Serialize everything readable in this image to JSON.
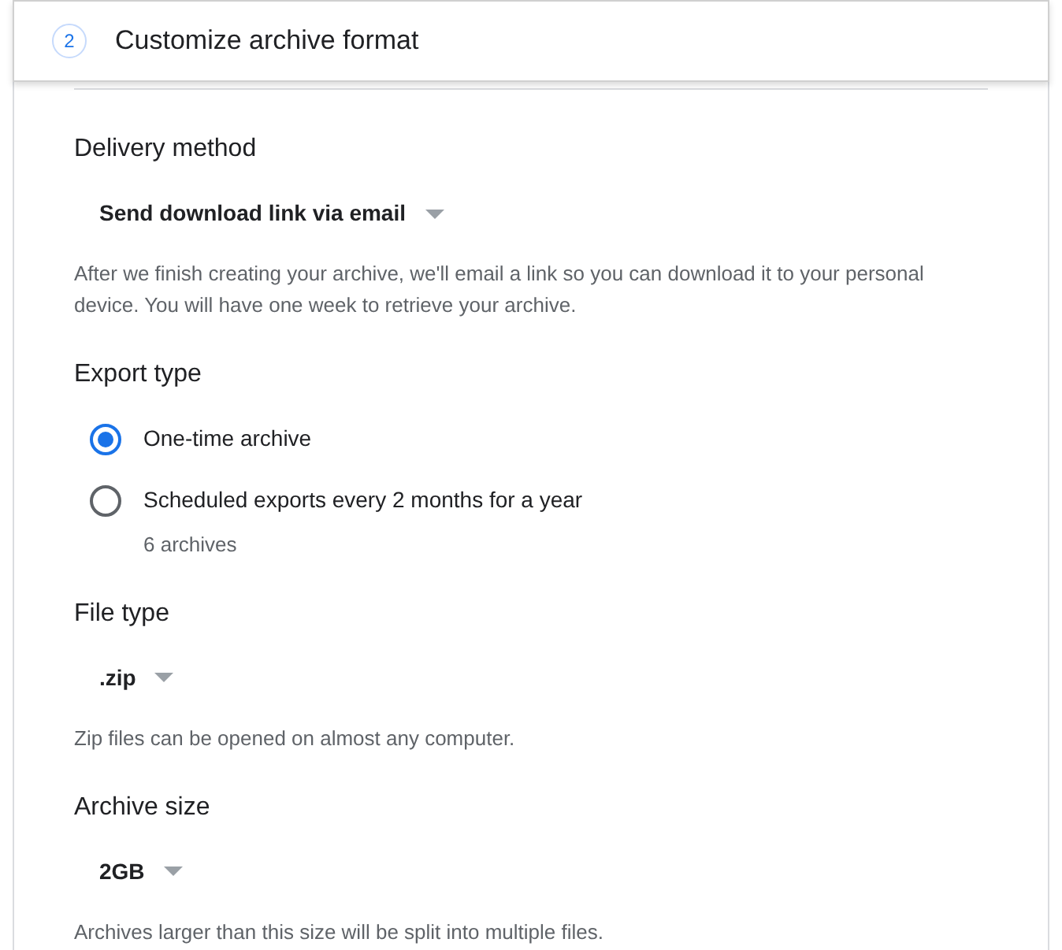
{
  "step": {
    "number": "2",
    "title": "Customize archive format"
  },
  "sections": [
    {
      "kind": "dropdown",
      "heading": "Delivery method",
      "value": "Send download link via email",
      "help": "After we finish creating your archive, we'll email a link so you can download it to your personal device. You will have one week to retrieve your archive."
    },
    {
      "kind": "radio",
      "heading": "Export type",
      "options": [
        {
          "label": "One-time archive",
          "selected": true
        },
        {
          "label": "Scheduled exports every 2 months for a year",
          "selected": false,
          "note": "6 archives"
        }
      ]
    },
    {
      "kind": "dropdown",
      "heading": "File type",
      "value": ".zip",
      "help": "Zip files can be opened on almost any computer."
    },
    {
      "kind": "dropdown",
      "heading": "Archive size",
      "value": "2GB",
      "help": "Archives larger than this size will be split into multiple files."
    }
  ]
}
